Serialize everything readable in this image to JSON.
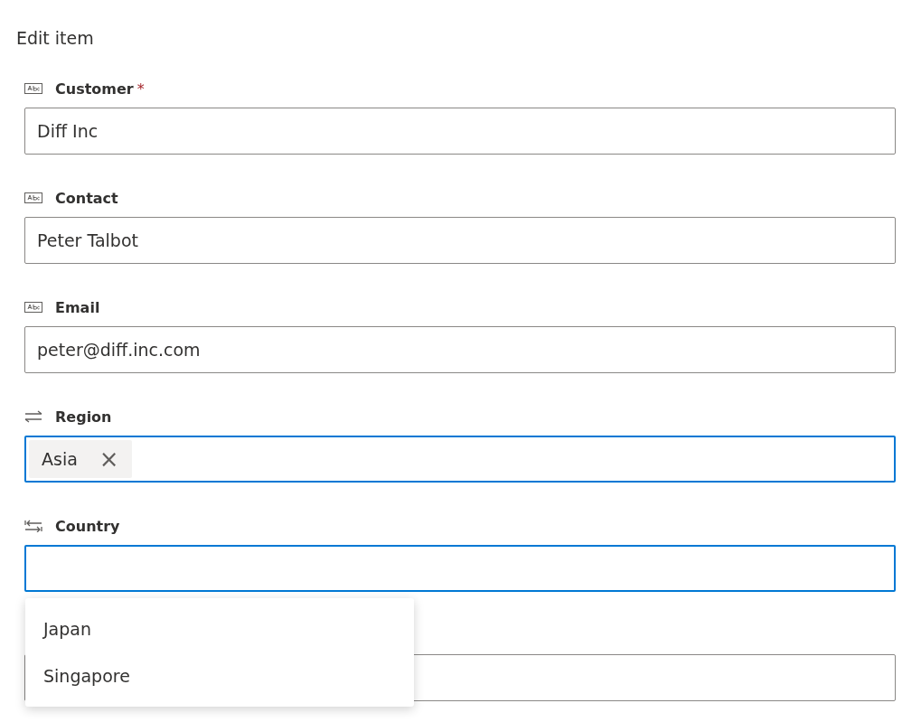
{
  "title": "Edit item",
  "fields": [
    {
      "kind": "text",
      "label": "Customer",
      "required_mark": "*",
      "value": "Diff Inc",
      "focused": false
    },
    {
      "kind": "text",
      "label": "Contact",
      "value": "Peter Talbot",
      "focused": false
    },
    {
      "kind": "text",
      "label": "Email",
      "value": "peter@diff.inc.com",
      "focused": false
    },
    {
      "kind": "lookup",
      "label": "Region",
      "tags": [
        {
          "label": "Asia",
          "remove": "×"
        }
      ],
      "focused": true
    },
    {
      "kind": "multi",
      "label": "Country",
      "focused": true,
      "suggestions": [
        "Japan",
        "Singapore"
      ]
    },
    {
      "kind": "hidden",
      "focused": false
    }
  ]
}
